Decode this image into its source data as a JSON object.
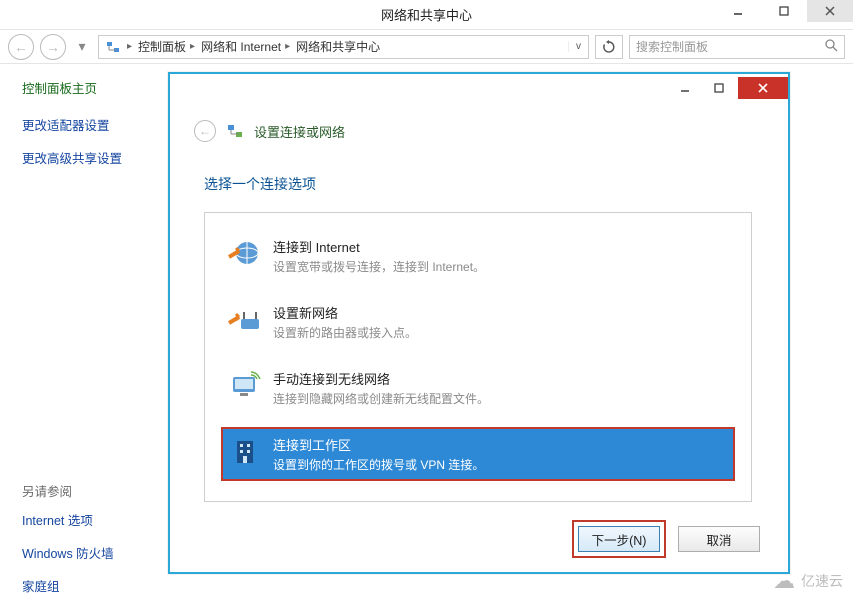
{
  "window": {
    "title": "网络和共享中心"
  },
  "breadcrumb": {
    "items": [
      "控制面板",
      "网络和 Internet",
      "网络和共享中心"
    ]
  },
  "search": {
    "placeholder": "搜索控制面板"
  },
  "sidebar": {
    "home": "控制面板主页",
    "links": [
      "更改适配器设置",
      "更改高级共享设置"
    ],
    "see_also_label": "另请参阅",
    "see_also": [
      "Internet 选项",
      "Windows 防火墙",
      "家庭组"
    ]
  },
  "dialog": {
    "header_title": "设置连接或网络",
    "section_title": "选择一个连接选项",
    "options": [
      {
        "title": "连接到 Internet",
        "desc": "设置宽带或拨号连接，连接到 Internet。"
      },
      {
        "title": "设置新网络",
        "desc": "设置新的路由器或接入点。"
      },
      {
        "title": "手动连接到无线网络",
        "desc": "连接到隐藏网络或创建新无线配置文件。"
      },
      {
        "title": "连接到工作区",
        "desc": "设置到你的工作区的拨号或 VPN 连接。"
      }
    ],
    "selected_index": 3,
    "buttons": {
      "next": "下一步(N)",
      "cancel": "取消"
    }
  },
  "watermark": "亿速云"
}
